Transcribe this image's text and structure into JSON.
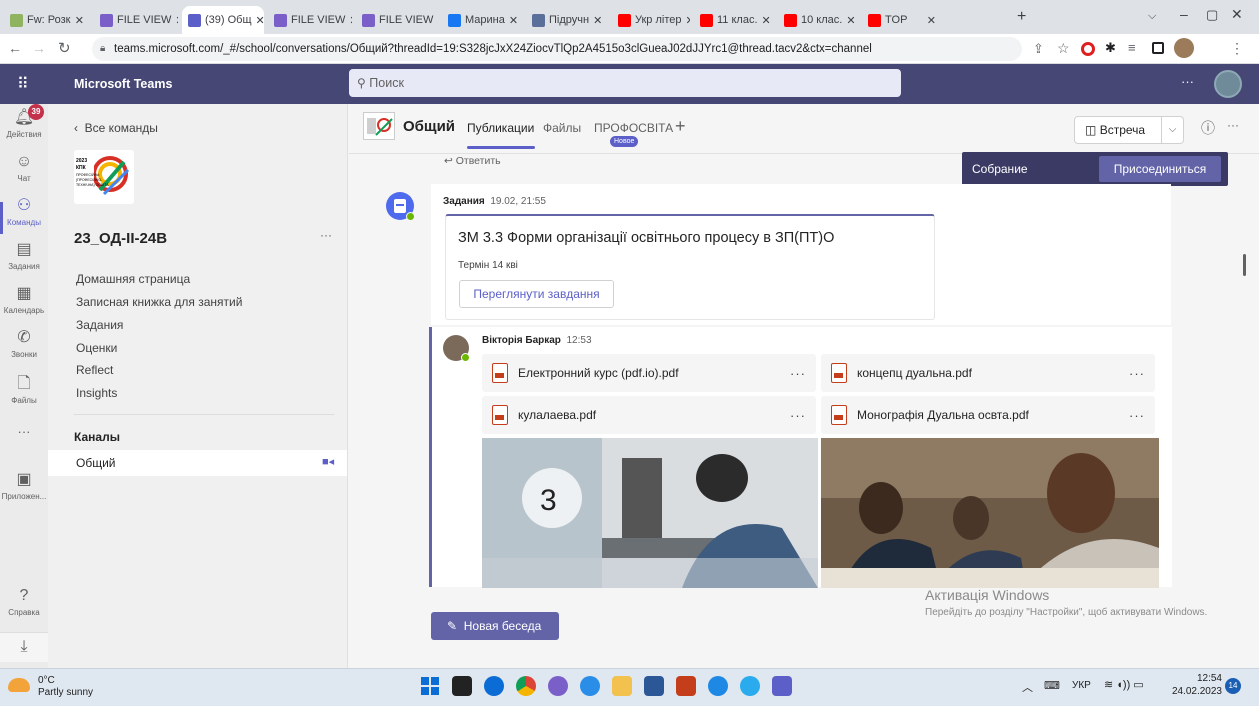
{
  "browser": {
    "tabs": [
      {
        "label": "Fw: Розк",
        "color": "#8fb35f"
      },
      {
        "label": "FILE VIEW",
        "color": "#7b5fc9"
      },
      {
        "label": "(39) Общ",
        "color": "#5b5fc7"
      },
      {
        "label": "FILE VIEW",
        "color": "#7b5fc9"
      },
      {
        "label": "FILE VIEW",
        "color": "#7b5fc9"
      },
      {
        "label": "Марина",
        "color": "#1877f2"
      },
      {
        "label": "Підручн",
        "color": "#5a6f9a"
      },
      {
        "label": "Укр літер",
        "color": "#ff0000"
      },
      {
        "label": "11 клас.",
        "color": "#ff0000"
      },
      {
        "label": "10 клас.",
        "color": "#ff0000"
      },
      {
        "label": "TOP",
        "color": "#ff0000"
      }
    ],
    "new_tab": "+",
    "url": "teams.microsoft.com/_#/school/conversations/Общий?threadId=19:S328jcJxX24ZiocvTlQp2A4515o3clGueaJ02dJJYrc1@thread.tacv2&ctx=channel"
  },
  "teams": {
    "app_name": "Microsoft Teams",
    "search_placeholder": "Поиск",
    "more": "···"
  },
  "appbar": [
    {
      "label": "Действия",
      "icon": "bell-icon",
      "badge": "39"
    },
    {
      "label": "Чат",
      "icon": "chat-icon"
    },
    {
      "label": "Команды",
      "icon": "teams-icon"
    },
    {
      "label": "Задания",
      "icon": "assignments-icon"
    },
    {
      "label": "Календарь",
      "icon": "calendar-icon"
    },
    {
      "label": "Звонки",
      "icon": "calls-icon"
    },
    {
      "label": "Файлы",
      "icon": "files-icon"
    },
    {
      "label": "···",
      "icon": "more-icon"
    },
    {
      "label": "Приложен...",
      "icon": "apps-icon"
    },
    {
      "label": "Справка",
      "icon": "help-icon"
    }
  ],
  "team_panel": {
    "back": "Все команды",
    "team_name": "23_ОД-II-24В",
    "logo_text": "2023 КПК ПРОФЕСІЙНА (ПРОФЕСІЙНО-ТЕХНІЧНА) ОСВІТА",
    "nav": [
      "Домашняя страница",
      "Записная книжка для занятий",
      "Задания",
      "Оценки",
      "Reflect",
      "Insights"
    ],
    "channels_title": "Каналы",
    "channel": "Общий"
  },
  "channel": {
    "name": "Общий",
    "tabs": [
      "Публикации",
      "Файлы",
      "ПРОФОСВІТА"
    ],
    "new_badge": "Новое",
    "meet_label": "Встреча",
    "meeting_banner": "Собрание",
    "join_label": "Присоединиться"
  },
  "posts": {
    "reply": "Ответить",
    "assignment": {
      "author": "Задания",
      "time": "19.02, 21:55",
      "title": "ЗМ 3.3 Форми організації освітнього процесу в ЗП(ПТ)О",
      "due": "Термін 14 кві",
      "button": "Переглянути завдання"
    },
    "message": {
      "author": "Вікторія Баркар",
      "time": "12:53",
      "files": [
        "Електронний курс (pdf.io).pdf",
        "концепц дуальна.pdf",
        "кулалаева.pdf",
        "Монографія Дуальна освта.pdf"
      ]
    },
    "new_conversation": "Новая беседа"
  },
  "watermark": {
    "title": "Активація Windows",
    "text": "Перейдіть до розділу \"Настройки\", щоб активувати Windows."
  },
  "taskbar": {
    "weather_temp": "0°C",
    "weather_desc": "Partly sunny",
    "lang": "УКР",
    "time": "12:54",
    "date": "24.02.2023",
    "notif": "14"
  }
}
